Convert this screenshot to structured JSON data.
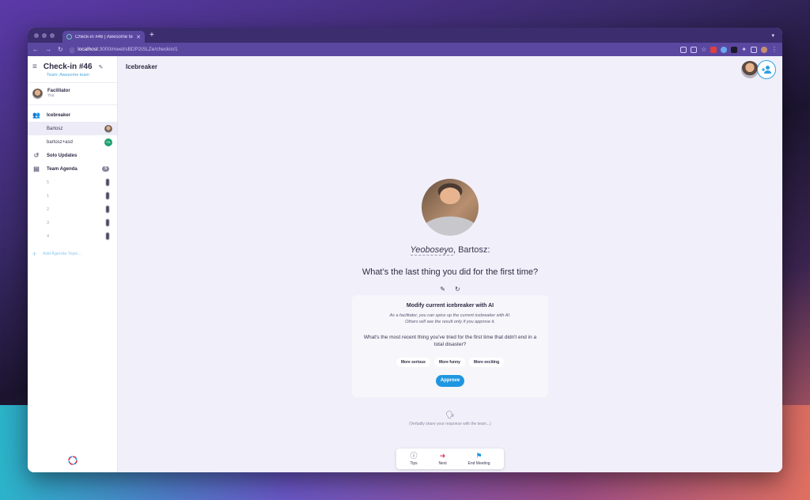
{
  "browser": {
    "tab_title": "Check-in #46 | Awesome tea",
    "new_tab": "+",
    "url_host": "localhost",
    "url_path": ":3000/meet/sBDP2iSLZe/checkin/1"
  },
  "sidebar": {
    "meeting_title": "Check-in #46",
    "team_name": "Team: Awesome team",
    "facilitator_label": "Facilitator",
    "facilitator_sub": "You",
    "icebreaker_label": "Icebreaker",
    "participants": [
      {
        "name": "Bartosz"
      },
      {
        "name": "bartosz+asd",
        "initials": "FA"
      }
    ],
    "solo_updates_label": "Solo Updates",
    "team_agenda_label": "Team Agenda",
    "team_agenda_count": "5",
    "agenda_items": [
      "5",
      "1",
      "2",
      "3",
      "4"
    ],
    "add_agenda_label": "Add Agenda Topic..."
  },
  "main": {
    "page_title": "Icebreaker",
    "greeting_word": "Yeoboseyo",
    "greeting_rest": ", Bartosz:",
    "question": "What’s the last thing you did for the first time?"
  },
  "ai_card": {
    "title": "Modify current icebreaker with AI",
    "desc_line1": "As a facilitator, you can spice up the current icebreaker with AI.",
    "desc_line2": "Others will see the result only if you approve it.",
    "question": "What's the most recent thing you've tried for the first time that didn't end in a total disaster?",
    "chips": [
      "More serious",
      "More funny",
      "More exciting"
    ],
    "approve_label": "Approve"
  },
  "share_text": "(Verbally share your response with the team...)",
  "bottom_bar": {
    "tips_label": "Tips",
    "next_label": "Next",
    "end_label": "End Meeting"
  },
  "colors": {
    "accent": "#1f97e0",
    "next_red": "#e0365a",
    "sidebar_active": "#ecebf7"
  }
}
